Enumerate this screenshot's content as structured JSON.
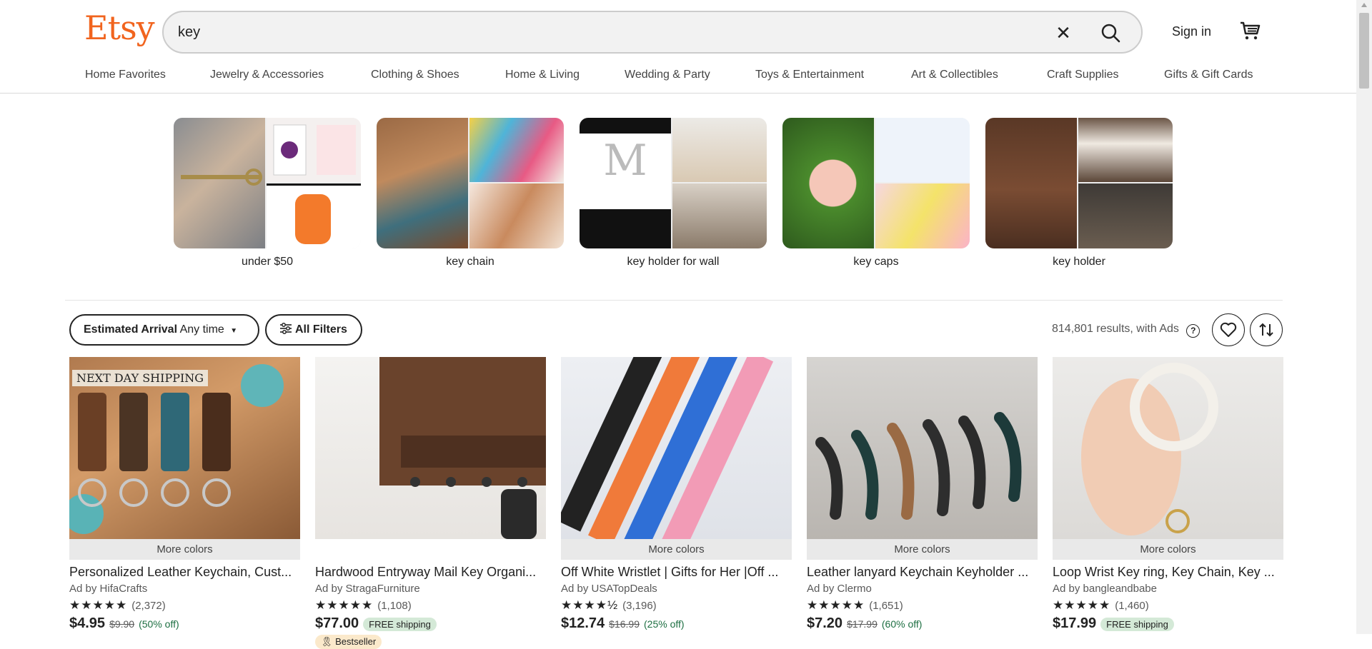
{
  "header": {
    "logo": "Etsy",
    "search_value": "key",
    "clear_glyph": "✕",
    "sign_in": "Sign in",
    "colors": {
      "brand": "#f1641e"
    }
  },
  "nav": {
    "items": [
      "Home Favorites",
      "Jewelry & Accessories",
      "Clothing & Shoes",
      "Home & Living",
      "Wedding & Party",
      "Toys & Entertainment",
      "Art & Collectibles",
      "Craft Supplies",
      "Gifts & Gift Cards"
    ]
  },
  "categories": [
    {
      "label": "under $50"
    },
    {
      "label": "key chain"
    },
    {
      "label": "key holder for wall"
    },
    {
      "label": "key caps"
    },
    {
      "label": "key holder"
    }
  ],
  "filters": {
    "arrival_label": "Estimated Arrival",
    "arrival_value": "Any time",
    "all_filters": "All Filters",
    "results": "814,801 results, with Ads",
    "help_glyph": "?"
  },
  "products": [
    {
      "overlay": "NEXT DAY SHIPPING",
      "more": "More colors",
      "title": "Personalized Leather Keychain, Cust...",
      "shop": "Ad by HifaCrafts",
      "stars": "★★★★★",
      "reviews": "(2,372)",
      "price": "$4.95",
      "old": "$9.90",
      "off": "(50% off)"
    },
    {
      "title": "Hardwood Entryway Mail Key Organi...",
      "shop": "Ad by StragaFurniture",
      "stars": "★★★★★",
      "reviews": "(1,108)",
      "price": "$77.00",
      "free": "FREE shipping",
      "badge": "Bestseller"
    },
    {
      "more": "More colors",
      "title": "Off White Wristlet | Gifts for Her |Off ...",
      "shop": "Ad by USATopDeals",
      "stars": "★★★★½",
      "reviews": "(3,196)",
      "price": "$12.74",
      "old": "$16.99",
      "off": "(25% off)"
    },
    {
      "more": "More colors",
      "title": "Leather lanyard Keychain Keyholder ...",
      "shop": "Ad by Clermo",
      "stars": "★★★★★",
      "reviews": "(1,651)",
      "price": "$7.20",
      "old": "$17.99",
      "off": "(60% off)"
    },
    {
      "more": "More colors",
      "title": "Loop Wrist Key ring, Key Chain, Key ...",
      "shop": "Ad by bangleandbabe",
      "stars": "★★★★★",
      "reviews": "(1,460)",
      "price": "$17.99",
      "free": "FREE shipping"
    }
  ]
}
